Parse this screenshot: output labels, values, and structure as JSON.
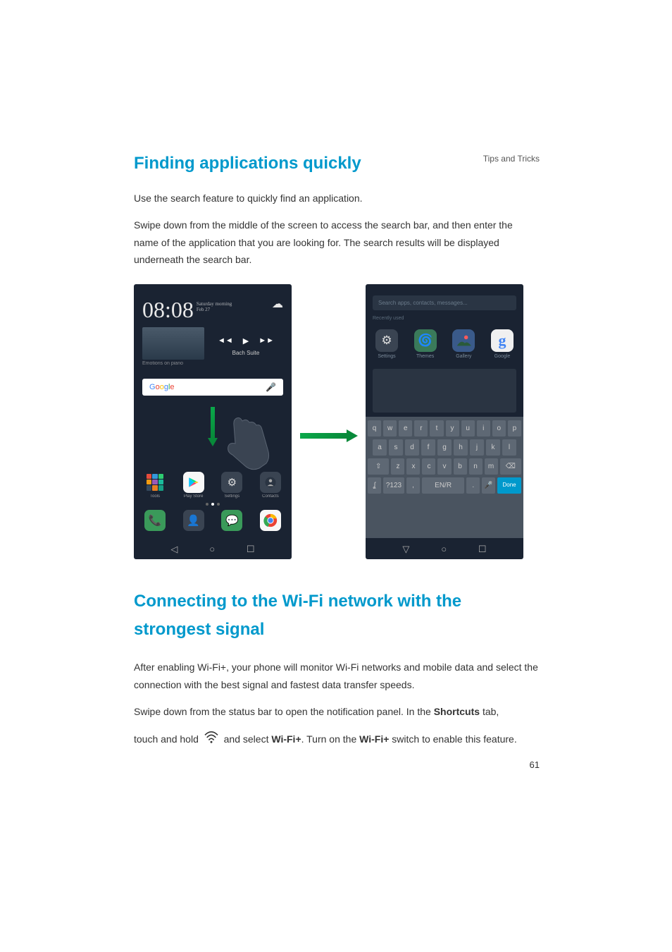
{
  "header": {
    "chapter": "Tips and Tricks"
  },
  "section1": {
    "title": "Finding applications quickly",
    "p1": "Use the search feature to quickly find an application.",
    "p2": "Swipe down from the middle of the screen to access the search bar, and then enter the name of the application that you are looking for. The search results will be displayed underneath the search bar."
  },
  "phone1": {
    "time": "08:08",
    "day": "Saturday morning",
    "date": "Feb 27",
    "album_sub": "Emotions on piano",
    "track": "Bach Suite",
    "google": "Google",
    "apps_row1": [
      "Tools",
      "Play Store",
      "Settings",
      "Contacts"
    ],
    "apps_row2": [
      "",
      "",
      "",
      ""
    ]
  },
  "phone2": {
    "search_placeholder": "Search apps, contacts, messages...",
    "recent_label": "Recently used",
    "results": [
      {
        "label": "Settings"
      },
      {
        "label": "Themes"
      },
      {
        "label": "Gallery"
      },
      {
        "label": "Google"
      }
    ],
    "kb_row1": [
      "q",
      "w",
      "e",
      "r",
      "t",
      "y",
      "u",
      "i",
      "o",
      "p"
    ],
    "kb_row2": [
      "a",
      "s",
      "d",
      "f",
      "g",
      "h",
      "j",
      "k",
      "l"
    ],
    "kb_row3": [
      "⇧",
      "z",
      "x",
      "c",
      "v",
      "b",
      "n",
      "m",
      "⌫"
    ],
    "kb_row4": [
      "ʆ",
      "?123",
      ",",
      "EN/R",
      ".",
      "🎤",
      "Done"
    ]
  },
  "section2": {
    "title": "Connecting to the Wi-Fi network with the strongest signal",
    "p1": "After enabling Wi-Fi+, your phone will monitor Wi-Fi networks and mobile data and select the connection with the best signal and fastest data transfer speeds.",
    "p2_a": "Swipe down from the status bar to open the notification panel. In the ",
    "p2_b": "Shortcuts",
    "p2_c": " tab, ",
    "p3_a": "touch and hold ",
    "p3_b": " and select ",
    "p3_c": "Wi-Fi+",
    "p3_d": ". Turn on the ",
    "p3_e": "Wi-Fi+",
    "p3_f": " switch to enable this feature."
  },
  "page_number": "61"
}
